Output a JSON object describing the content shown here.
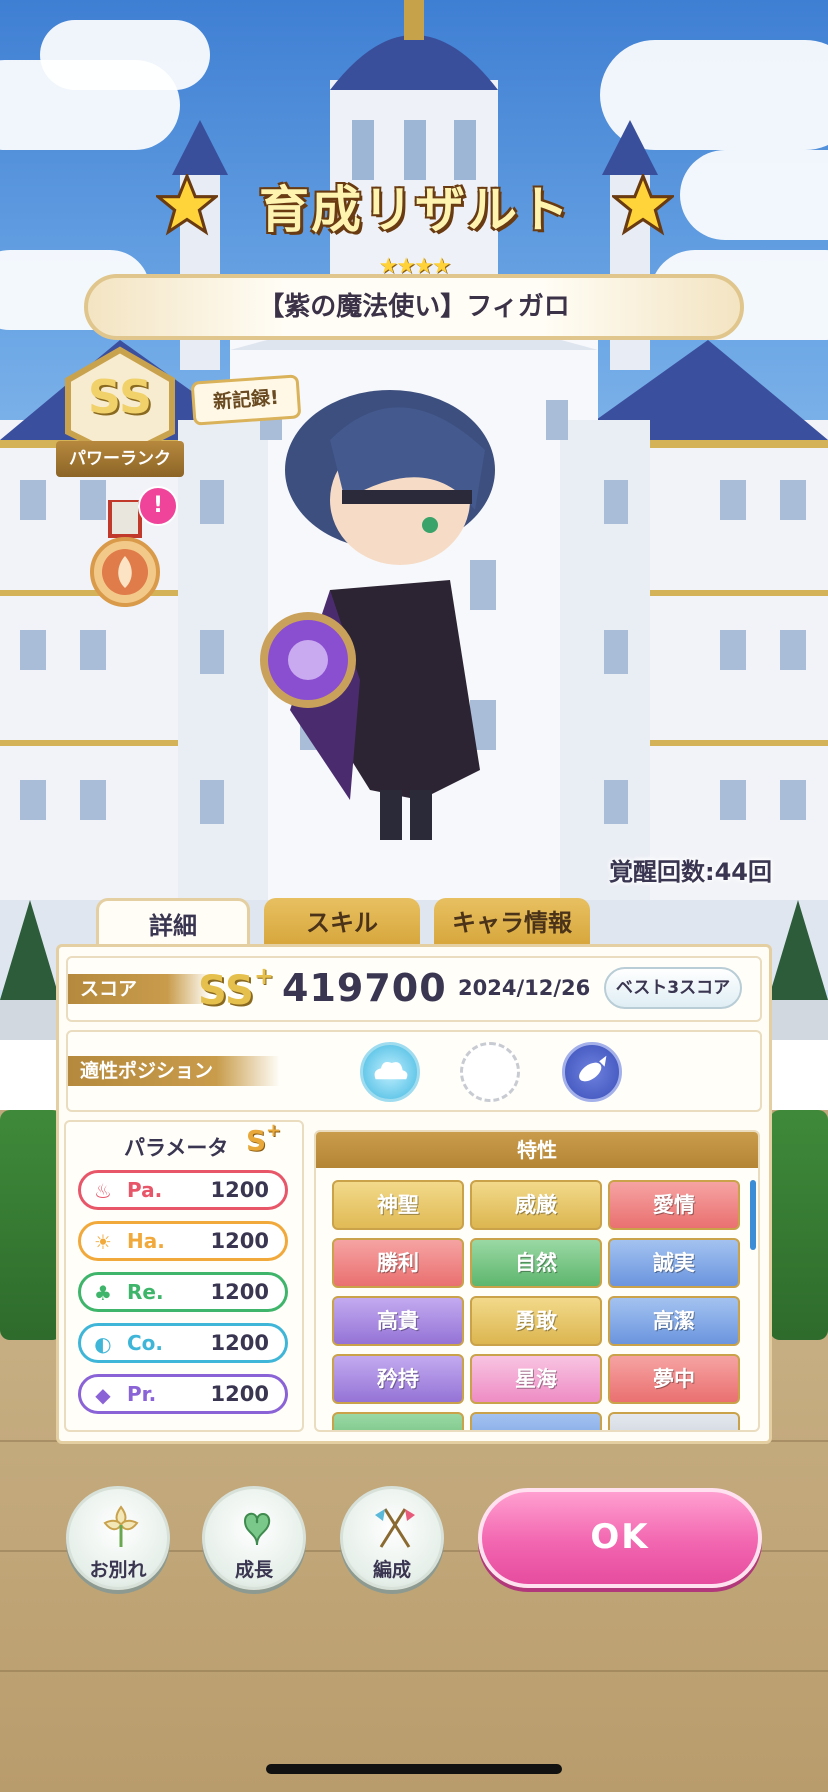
{
  "header": {
    "title": "育成リザルト",
    "rarity_stars": "★★★★",
    "character_name": "【紫の魔法使い】フィガロ"
  },
  "rank": {
    "grade": "SS",
    "label": "パワーランク",
    "new_record": "新記録!",
    "alert": "!"
  },
  "awaken": {
    "text": "覚醒回数:44回"
  },
  "tabs": [
    {
      "label": "詳細",
      "active": true
    },
    {
      "label": "スキル",
      "active": false
    },
    {
      "label": "キャラ情報",
      "active": false
    }
  ],
  "score": {
    "label": "スコア",
    "grade": "SS",
    "grade_plus": "+",
    "value": "419700",
    "date": "2024/12/26",
    "best3_button": "ベスト3スコア"
  },
  "position": {
    "label": "適性ポジション",
    "icons": [
      "cloud-position-icon",
      "empty-position-slot",
      "fish-position-icon"
    ]
  },
  "params": {
    "title": "パラメータ",
    "grade": "S",
    "grade_plus": "+",
    "items": [
      {
        "name": "Pa.",
        "value": "1200",
        "color": "#e8566a",
        "icon": "flame-icon"
      },
      {
        "name": "Ha.",
        "value": "1200",
        "color": "#f2a93b",
        "icon": "sun-icon"
      },
      {
        "name": "Re.",
        "value": "1200",
        "color": "#3fb56b",
        "icon": "clover-icon"
      },
      {
        "name": "Co.",
        "value": "1200",
        "color": "#3fb6d8",
        "icon": "swirl-icon"
      },
      {
        "name": "Pr.",
        "value": "1200",
        "color": "#8a63d6",
        "icon": "gem-icon"
      }
    ]
  },
  "traits": {
    "title": "特性",
    "items": [
      {
        "label": "神聖",
        "color": "#e7c25a"
      },
      {
        "label": "威厳",
        "color": "#e2be5b"
      },
      {
        "label": "愛情",
        "color": "#ef7b7b"
      },
      {
        "label": "勝利",
        "color": "#ee7c7c"
      },
      {
        "label": "自然",
        "color": "#6cc27a"
      },
      {
        "label": "誠実",
        "color": "#6e9de0"
      },
      {
        "label": "高貴",
        "color": "#9b78d8"
      },
      {
        "label": "勇敢",
        "color": "#e3be5a"
      },
      {
        "label": "高潔",
        "color": "#6e9de0"
      },
      {
        "label": "矜持",
        "color": "#9b78d8"
      },
      {
        "label": "星海",
        "color": "#f09acb"
      },
      {
        "label": "夢中",
        "color": "#ef7b7b"
      }
    ]
  },
  "buttons": {
    "farewell": "お別れ",
    "growth": "成長",
    "formation": "編成",
    "ok": "OK"
  }
}
